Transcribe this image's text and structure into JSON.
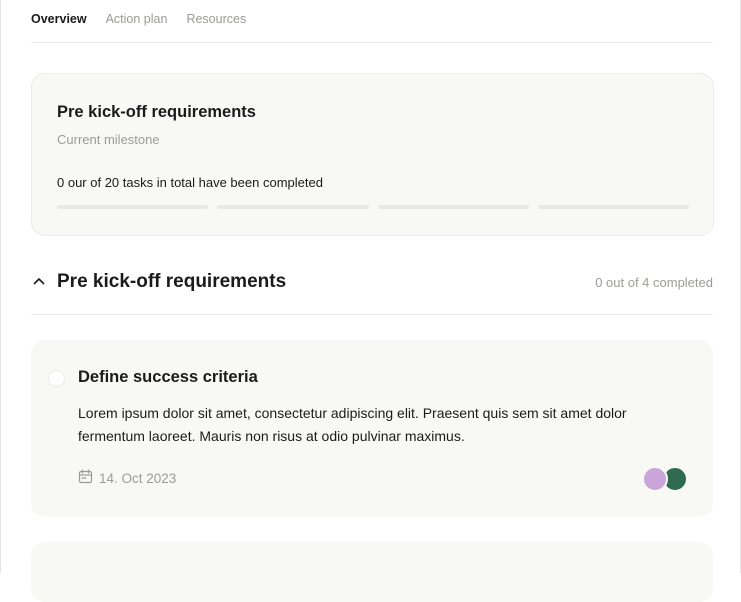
{
  "tabs": [
    {
      "label": "Overview",
      "active": true
    },
    {
      "label": "Action plan",
      "active": false
    },
    {
      "label": "Resources",
      "active": false
    }
  ],
  "milestone": {
    "title": "Pre kick-off requirements",
    "subtitle": "Current milestone",
    "summary": "0 our of 20 tasks in total have been completed",
    "progress_segments": [
      0,
      0,
      0,
      0
    ]
  },
  "section": {
    "title": "Pre kick-off requirements",
    "count_text": "0 out of 4 completed",
    "expanded": true
  },
  "tasks": [
    {
      "title": "Define success criteria",
      "description": "Lorem ipsum dolor sit amet, consectetur adipiscing elit. Praesent quis sem sit amet dolor fermentum laoreet. Mauris non risus at odio pulvinar maximus.",
      "due_date": "14. Oct 2023",
      "completed": false,
      "assignee_colors": [
        "#c9a5d9",
        "#2f6b50"
      ]
    }
  ],
  "colors": {
    "card_bg": "#f8f9f4",
    "muted_text": "#9c9c97",
    "accent_green": "#2f6b50"
  }
}
